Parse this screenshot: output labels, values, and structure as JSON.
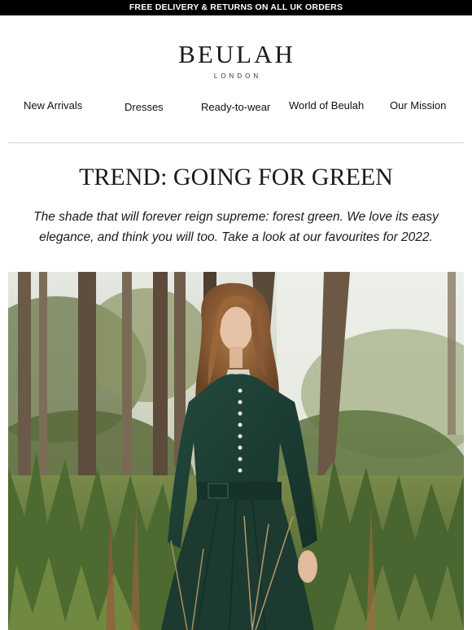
{
  "promo": {
    "text": "FREE DELIVERY & RETURNS ON ALL UK ORDERS"
  },
  "brand": {
    "name": "BEULAH",
    "subtitle": "LONDON"
  },
  "nav": {
    "items": [
      {
        "label": "New Arrivals"
      },
      {
        "label": "Dresses"
      },
      {
        "label": "Ready-to-wear"
      },
      {
        "label": "World of Beulah"
      },
      {
        "label": "Our Mission"
      }
    ]
  },
  "article": {
    "title": "TREND: GOING FOR GREEN",
    "intro": "The shade that will forever reign supreme: forest green. We love its easy elegance, and think you will too. Take a look at our favourites for 2022."
  },
  "colors": {
    "promo_bg": "#000000",
    "dress": "#1f3d33",
    "foliage": "#4f6638",
    "hair": "#8a5a34"
  }
}
